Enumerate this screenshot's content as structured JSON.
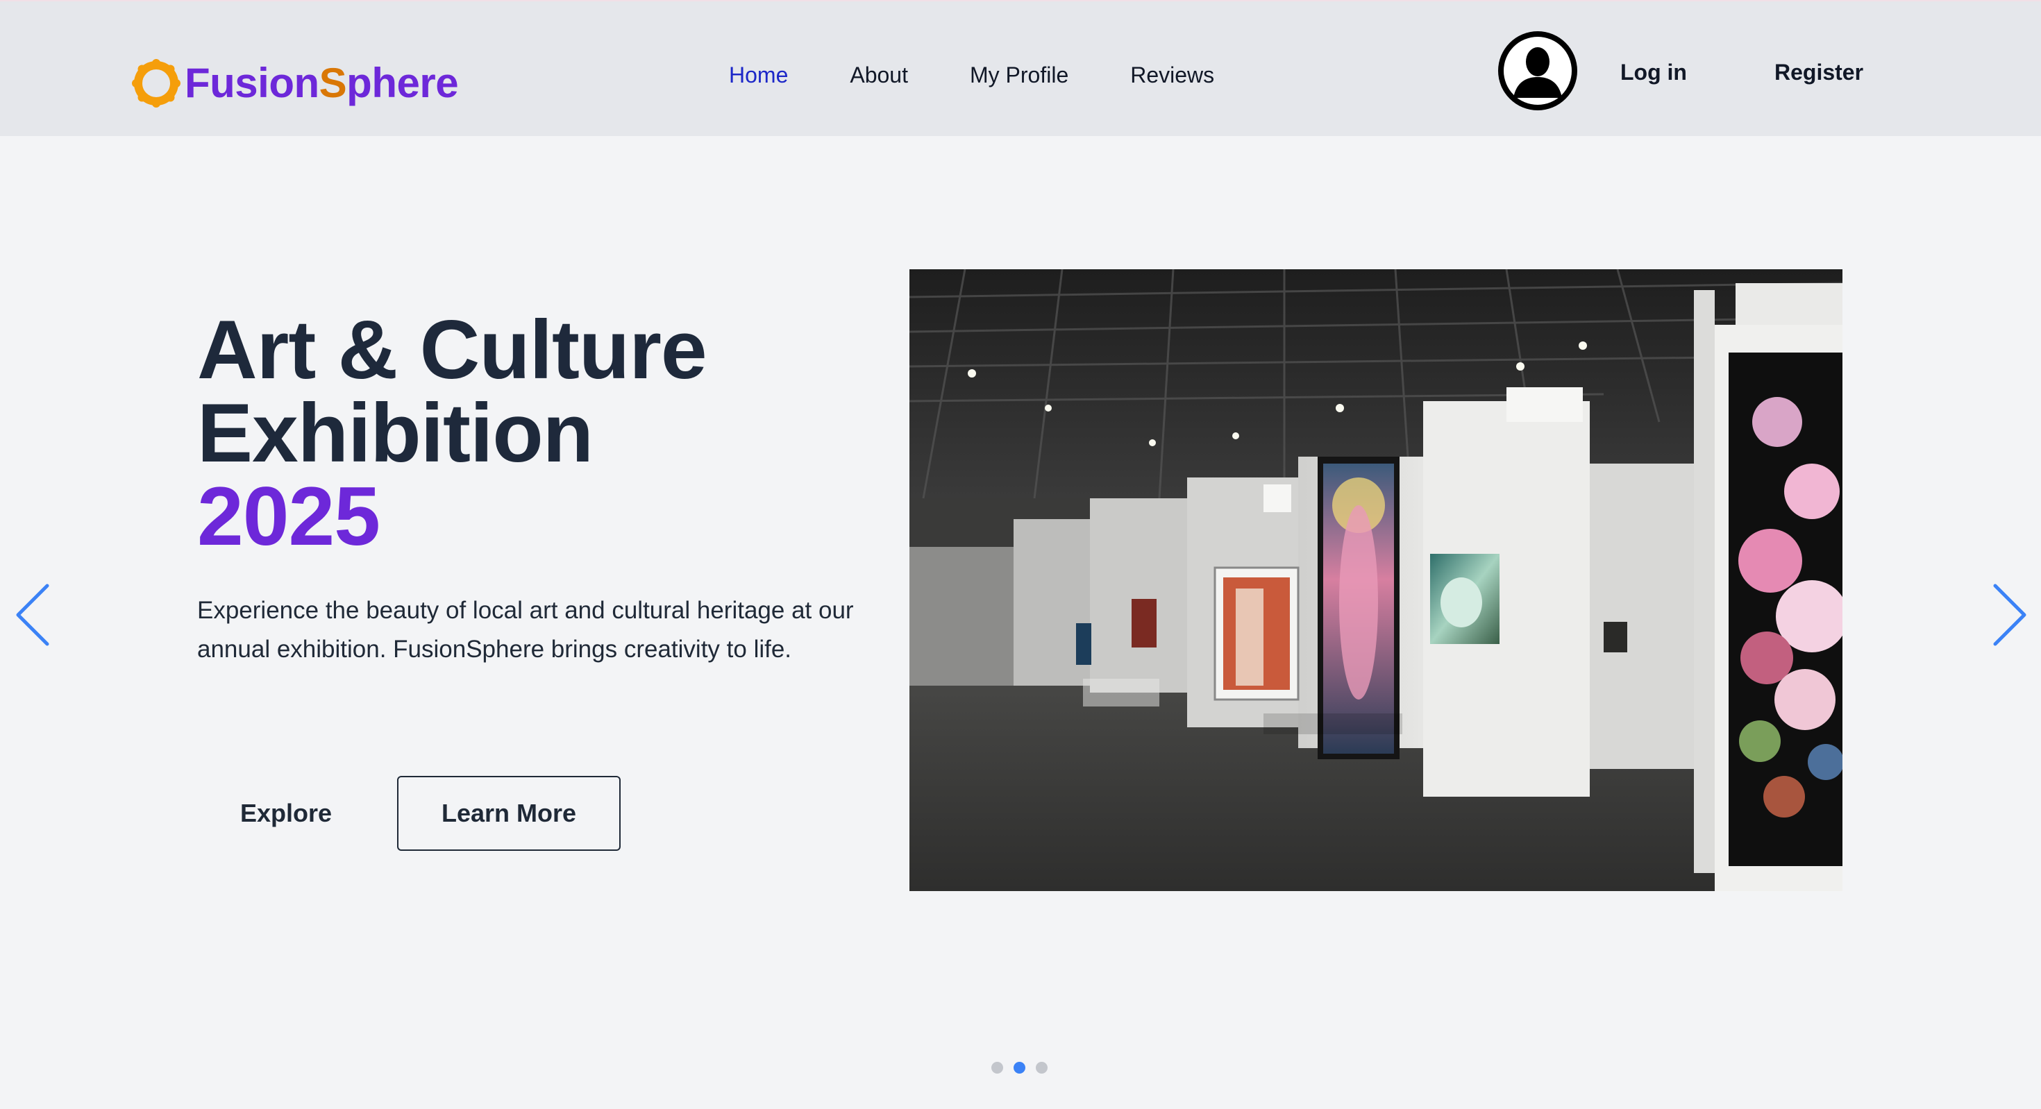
{
  "brand": {
    "part1": "Fusion",
    "part2": "S",
    "part3": "phere",
    "colors": {
      "primary": "#6d28d9",
      "accent": "#d97706"
    },
    "icon": "orange-ring-logo-icon"
  },
  "nav": {
    "items": [
      {
        "label": "Home",
        "active": true
      },
      {
        "label": "About",
        "active": false
      },
      {
        "label": "My Profile",
        "active": false
      },
      {
        "label": "Reviews",
        "active": false
      }
    ],
    "active_color": "#1d28c8"
  },
  "header_actions": {
    "avatar_icon": "user-avatar-icon",
    "login_label": "Log in",
    "register_label": "Register"
  },
  "hero": {
    "title_line1": "Art & Culture",
    "title_line2": "Exhibition",
    "title_year": "2025",
    "description": "Experience the beauty of local art and cultural heritage at our annual exhibition. FusionSphere brings creativity to life.",
    "explore_label": "Explore",
    "learn_more_label": "Learn More",
    "image_icon": "gallery-photo"
  },
  "carousel": {
    "prev_icon": "chevron-left-icon",
    "next_icon": "chevron-right-icon",
    "slide_count": 3,
    "active_slide": 2,
    "arrow_color": "#3b82f6"
  }
}
